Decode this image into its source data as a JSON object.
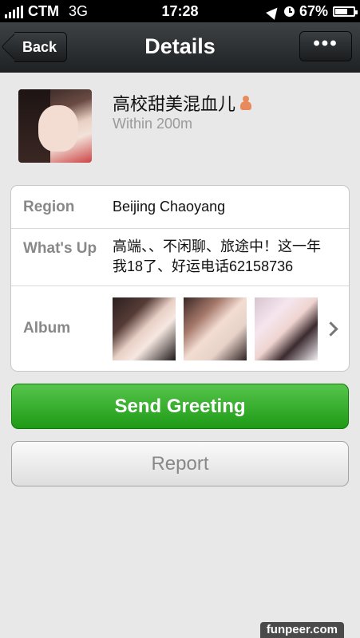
{
  "status_bar": {
    "carrier": "CTM",
    "network": "3G",
    "time": "17:28",
    "battery_percent_text": "67%",
    "battery_level": 0.67
  },
  "navbar": {
    "back_label": "Back",
    "title": "Details",
    "more_label": "•••"
  },
  "profile": {
    "name": "高校甜美混血儿",
    "distance": "Within 200m",
    "gender_icon": "female-icon"
  },
  "details": {
    "region_label": "Region",
    "region_value": "Beijing Chaoyang",
    "whatsup_label": "What's Up",
    "whatsup_value": "高端、、不闲聊、旅途中！这一年我18了、好运电话62158736",
    "album_label": "Album"
  },
  "actions": {
    "send_greeting": "Send Greeting",
    "report": "Report"
  },
  "watermark": "funpeer.com",
  "colors": {
    "accent_green": "#1f9a16",
    "navbar_dark": "#1f2224",
    "background": "#e8e8e8"
  }
}
